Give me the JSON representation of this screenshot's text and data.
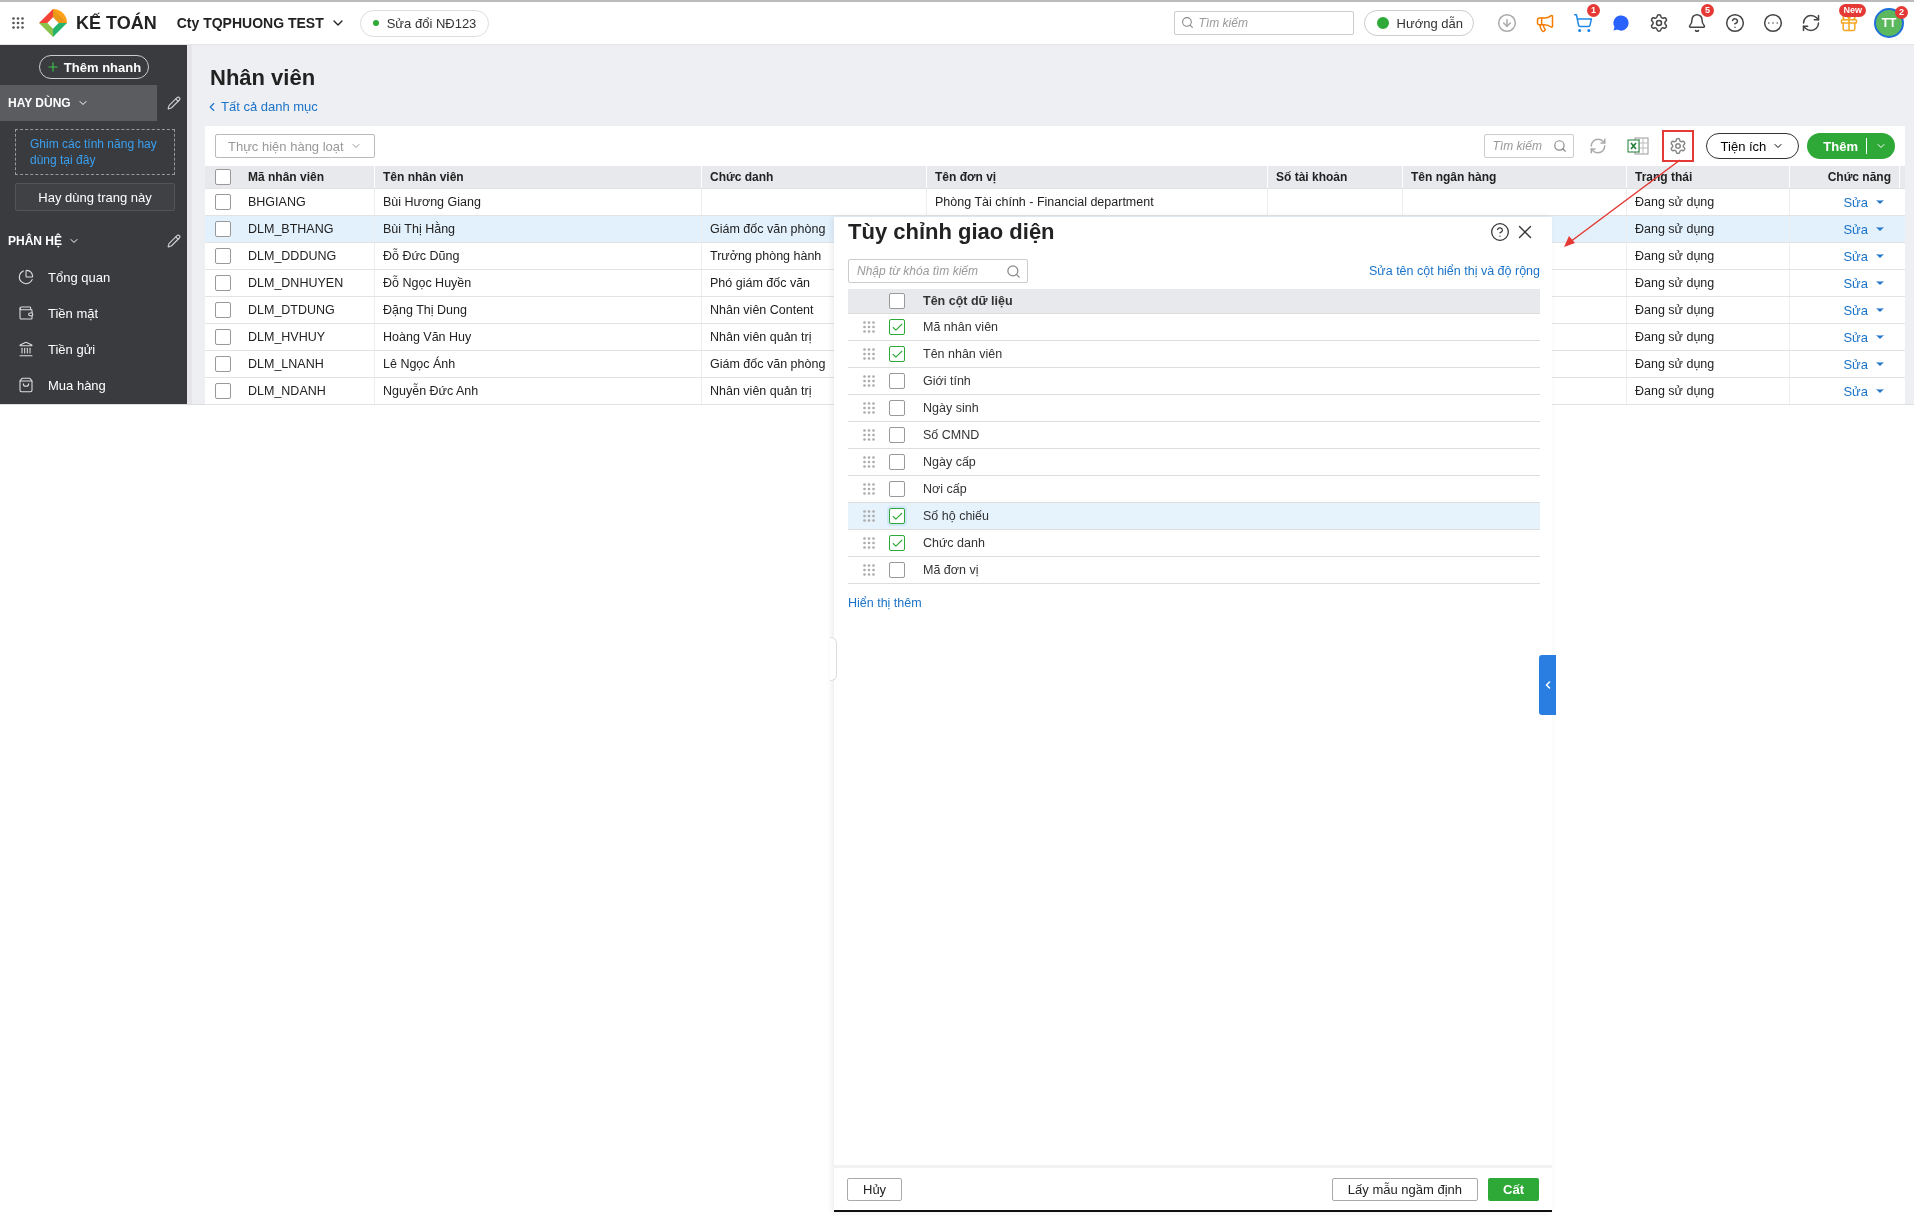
{
  "topbar": {
    "brand": "KẾ TOÁN",
    "company": "Cty TQPHUONG TEST",
    "edition": "Sửa đổi NĐ123",
    "search_placeholder": "Tìm kiếm",
    "guide": "Hướng dẫn",
    "icons": [
      {
        "kind": "download"
      },
      {
        "kind": "megaphone"
      },
      {
        "kind": "cart",
        "badge": "1"
      },
      {
        "kind": "chat"
      },
      {
        "kind": "settings"
      },
      {
        "kind": "bell",
        "badge": "5"
      },
      {
        "kind": "help"
      },
      {
        "kind": "more"
      },
      {
        "kind": "sync"
      },
      {
        "kind": "gift",
        "badge": "New"
      }
    ],
    "avatar": {
      "initials": "TT",
      "badge": "2"
    }
  },
  "sidebar": {
    "quick_add": "Thêm nhanh",
    "favorites": {
      "title": "HAY DÙNG",
      "hint": "Ghim các tính năng hay dùng tại đây",
      "button": "Hay dùng trang này"
    },
    "modules": {
      "title": "PHÂN HỆ",
      "items": [
        {
          "kind": "overview",
          "label": "Tổng quan"
        },
        {
          "kind": "cash",
          "label": "Tiền mặt"
        },
        {
          "kind": "bank",
          "label": "Tiền gửi"
        },
        {
          "kind": "purchase",
          "label": "Mua hàng"
        }
      ]
    }
  },
  "page": {
    "title": "Nhân viên",
    "back_link": "Tất cả danh mục"
  },
  "toolbar": {
    "bulk_action": "Thực hiện hàng loạt",
    "search_placeholder": "Tìm kiếm",
    "utilities": "Tiện ích",
    "add": "Thêm",
    "settings_highlighted": true
  },
  "table": {
    "all_checked": false,
    "columns": [
      "Mã nhân viên",
      "Tên nhân viên",
      "Chức danh",
      "Tên đơn vị",
      "Số tài khoản",
      "Tên ngân hàng",
      "Trạng thái",
      "Chức năng"
    ],
    "rows": [
      {
        "checked": false,
        "selected": false,
        "cells": [
          "BHGIANG",
          "Bùi Hương Giang",
          "",
          "Phòng Tài chính - Financial department",
          "",
          "",
          "Đang sử dụng",
          "Sửa"
        ]
      },
      {
        "checked": false,
        "selected": true,
        "cells": [
          "DLM_BTHANG",
          "Bùi Thị Hằng",
          "Giám đốc văn phòng",
          "",
          "",
          "",
          "Đang sử dụng",
          "Sửa"
        ]
      },
      {
        "checked": false,
        "selected": false,
        "cells": [
          "DLM_DDDUNG",
          "Đỗ Đức Dũng",
          "Trưởng phòng hành",
          "",
          "",
          "",
          "Đang sử dụng",
          "Sửa"
        ]
      },
      {
        "checked": false,
        "selected": false,
        "cells": [
          "DLM_DNHUYEN",
          "Đỗ Ngọc Huyền",
          "Phó giám đốc văn",
          "",
          "",
          "",
          "Đang sử dụng",
          "Sửa"
        ]
      },
      {
        "checked": false,
        "selected": false,
        "cells": [
          "DLM_DTDUNG",
          "Đặng Thị Dung",
          "Nhân viên Content",
          "",
          "",
          "",
          "Đang sử dụng",
          "Sửa"
        ]
      },
      {
        "checked": false,
        "selected": false,
        "cells": [
          "DLM_HVHUY",
          "Hoàng Văn Huy",
          "Nhân viên quản trị",
          "",
          "",
          "",
          "Đang sử dụng",
          "Sửa"
        ]
      },
      {
        "checked": false,
        "selected": false,
        "cells": [
          "DLM_LNANH",
          "Lê Ngọc Ánh",
          "Giám đốc văn phòng",
          "",
          "",
          "",
          "Đang sử dụng",
          "Sửa"
        ]
      },
      {
        "checked": false,
        "selected": false,
        "cells": [
          "DLM_NDANH",
          "Nguyễn Đức Anh",
          "Nhân viên quản trị",
          "",
          "",
          "",
          "Đang sử dụng",
          "Sửa"
        ]
      }
    ]
  },
  "dialog": {
    "title": "Tùy chỉnh giao diện",
    "search_placeholder": "Nhập từ khóa tìm kiếm",
    "edit_link": "Sửa tên cột hiển thị và độ rộng",
    "header": "Tên cột dữ liệu",
    "all_checked": false,
    "items": [
      {
        "label": "Mã nhân viên",
        "checked": true,
        "selected": false
      },
      {
        "label": "Tên nhân viên",
        "checked": true,
        "selected": false
      },
      {
        "label": "Giới tính",
        "checked": false,
        "selected": false
      },
      {
        "label": "Ngày sinh",
        "checked": false,
        "selected": false
      },
      {
        "label": "Số CMND",
        "checked": false,
        "selected": false
      },
      {
        "label": "Ngày cấp",
        "checked": false,
        "selected": false
      },
      {
        "label": "Nơi cấp",
        "checked": false,
        "selected": false
      },
      {
        "label": "Số hộ chiếu",
        "checked": true,
        "selected": true
      },
      {
        "label": "Chức danh",
        "checked": true,
        "selected": false
      },
      {
        "label": "Mã đơn vị",
        "checked": false,
        "selected": false
      }
    ],
    "show_more": "Hiển thị thêm",
    "cancel": "Hủy",
    "reset": "Lấy mẫu ngầm định",
    "save": "Cất"
  }
}
